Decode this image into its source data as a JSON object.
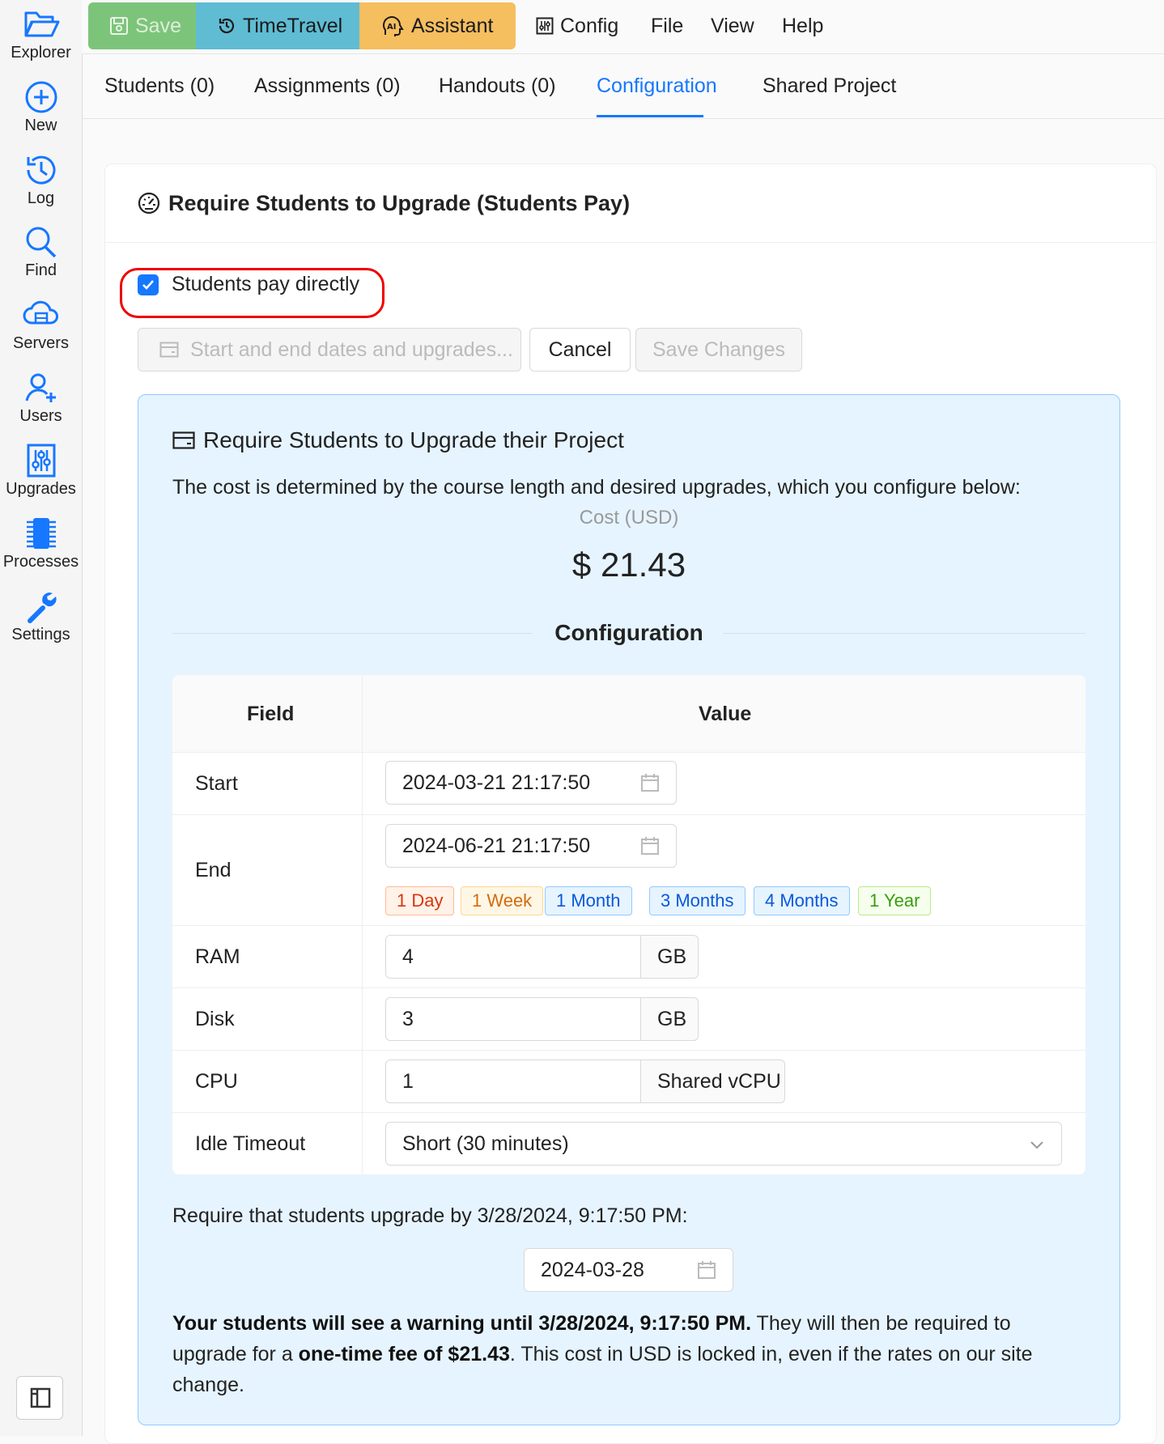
{
  "sidebar": {
    "items": [
      {
        "label": "Explorer",
        "icon": "folder-open-icon"
      },
      {
        "label": "New",
        "icon": "plus-circle-icon"
      },
      {
        "label": "Log",
        "icon": "history-icon"
      },
      {
        "label": "Find",
        "icon": "search-icon"
      },
      {
        "label": "Servers",
        "icon": "cloud-server-icon"
      },
      {
        "label": "Users",
        "icon": "users-icon"
      },
      {
        "label": "Upgrades",
        "icon": "sliders-icon"
      },
      {
        "label": "Processes",
        "icon": "chip-icon"
      },
      {
        "label": "Settings",
        "icon": "wrench-icon"
      }
    ],
    "bottom_icon": "layout-toggle-icon"
  },
  "topbar": {
    "save": "Save",
    "timetravel": "TimeTravel",
    "assistant": "Assistant",
    "config": "Config",
    "file": "File",
    "view": "View",
    "help": "Help"
  },
  "tabs": {
    "students": "Students (0)",
    "assignments": "Assignments (0)",
    "handouts": "Handouts (0)",
    "configuration": "Configuration",
    "shared": "Shared Project",
    "active": "Configuration"
  },
  "card": {
    "title": "Require Students to Upgrade (Students Pay)",
    "pay_checkbox_label": "Students pay directly",
    "pay_checked": true,
    "dates_button": "Start and end dates and upgrades...",
    "cancel_button": "Cancel",
    "save_changes_button": "Save Changes"
  },
  "panel": {
    "title": "Require Students to Upgrade their Project",
    "description": "The cost is determined by the course length and desired upgrades, which you configure below:",
    "cost_label": "Cost (USD)",
    "cost_value": "$ 21.43",
    "config_heading": "Configuration",
    "table": {
      "col_field": "Field",
      "col_value": "Value",
      "start_label": "Start",
      "start_value": "2024-03-21 21:17:50",
      "end_label": "End",
      "end_value": "2024-06-21 21:17:50",
      "presets": [
        "1 Day",
        "1 Week",
        "1 Month",
        "3 Months",
        "4 Months",
        "1 Year"
      ],
      "ram_label": "RAM",
      "ram_value": "4",
      "ram_unit": "GB",
      "disk_label": "Disk",
      "disk_value": "3",
      "disk_unit": "GB",
      "cpu_label": "CPU",
      "cpu_value": "1",
      "cpu_unit": "Shared vCPU",
      "idle_label": "Idle Timeout",
      "idle_value": "Short (30 minutes)"
    },
    "require_text": "Require that students upgrade by 3/28/2024, 9:17:50 PM:",
    "require_date": "2024-03-28",
    "warning_bold1": "Your students will see a warning until 3/28/2024, 9:17:50 PM.",
    "warning_text1": " They will then be required to upgrade for a ",
    "warning_bold2": "one-time fee of $21.43",
    "warning_text2": ". This cost in USD is locked in, even if the rates on our site change."
  },
  "colors": {
    "accent": "#1677ff",
    "save_green": "#7dc47b",
    "timetravel_blue": "#5fbcd3",
    "assistant_orange": "#f5be5f",
    "panel_bg": "#e6f4ff",
    "highlight_red": "#e00000"
  }
}
